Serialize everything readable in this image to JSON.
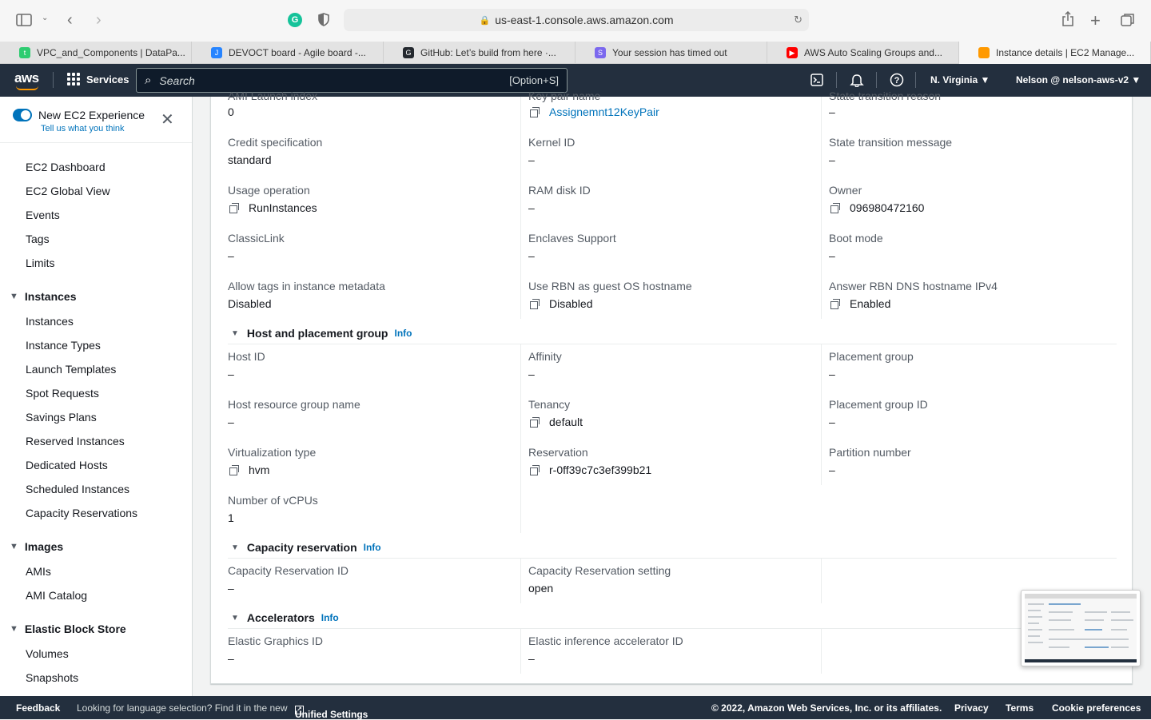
{
  "browser": {
    "url": "us-east-1.console.aws.amazon.com",
    "tabs": [
      {
        "title": "VPC_and_Components | DataPa...",
        "color": "#2ecc71",
        "glyph": "t"
      },
      {
        "title": "DEVOCT board - Agile board -...",
        "color": "#2684ff",
        "glyph": "J"
      },
      {
        "title": "GitHub: Let’s build from here ·...",
        "color": "#24292f",
        "glyph": "G"
      },
      {
        "title": "Your session has timed out",
        "color": "#7b68ee",
        "glyph": "S"
      },
      {
        "title": "AWS Auto Scaling Groups and...",
        "color": "#ff0000",
        "glyph": "▶"
      },
      {
        "title": "Instance details | EC2 Manage...",
        "color": "#ff9900",
        "glyph": "",
        "active": true
      }
    ]
  },
  "aws_nav": {
    "logo": "aws",
    "services": "Services",
    "search_placeholder": "Search",
    "search_shortcut": "[Option+S]",
    "region": "N. Virginia",
    "account": "Nelson @ nelson-aws-v2"
  },
  "sidebar": {
    "experience_title": "New EC2 Experience",
    "experience_link": "Tell us what you think",
    "top_items": [
      "EC2 Dashboard",
      "EC2 Global View",
      "Events",
      "Tags",
      "Limits"
    ],
    "sections": [
      {
        "title": "Instances",
        "items": [
          "Instances",
          "Instance Types",
          "Launch Templates",
          "Spot Requests",
          "Savings Plans",
          "Reserved Instances",
          "Dedicated Hosts",
          "Scheduled Instances",
          "Capacity Reservations"
        ]
      },
      {
        "title": "Images",
        "items": [
          "AMIs",
          "AMI Catalog"
        ]
      },
      {
        "title": "Elastic Block Store",
        "items": [
          "Volumes",
          "Snapshots"
        ]
      }
    ]
  },
  "details": {
    "clipped_labels": [
      "AMI Launch index",
      "Key pair name",
      "State transition reason"
    ],
    "top_values": {
      "launch_index": "0",
      "key_pair": "Assignemnt12KeyPair",
      "state_reason": "–"
    },
    "rows": [
      [
        {
          "label": "Credit specification",
          "value": "standard"
        },
        {
          "label": "Kernel ID",
          "value": "–"
        },
        {
          "label": "State transition message",
          "value": "–"
        }
      ],
      [
        {
          "label": "Usage operation",
          "value": "RunInstances",
          "copy": true
        },
        {
          "label": "RAM disk ID",
          "value": "–"
        },
        {
          "label": "Owner",
          "value": "096980472160",
          "copy": true
        }
      ],
      [
        {
          "label": "ClassicLink",
          "value": "–"
        },
        {
          "label": "Enclaves Support",
          "value": "–"
        },
        {
          "label": "Boot mode",
          "value": "–"
        }
      ],
      [
        {
          "label": "Allow tags in instance metadata",
          "value": "Disabled"
        },
        {
          "label": "Use RBN as guest OS hostname",
          "value": "Disabled",
          "copy": true
        },
        {
          "label": "Answer RBN DNS hostname IPv4",
          "value": "Enabled",
          "copy": true
        }
      ]
    ],
    "host_group": {
      "title": "Host and placement group",
      "info": "Info",
      "rows": [
        [
          {
            "label": "Host ID",
            "value": "–"
          },
          {
            "label": "Affinity",
            "value": "–"
          },
          {
            "label": "Placement group",
            "value": "–"
          }
        ],
        [
          {
            "label": "Host resource group name",
            "value": "–"
          },
          {
            "label": "Tenancy",
            "value": "default",
            "copy": true
          },
          {
            "label": "Placement group ID",
            "value": "–"
          }
        ],
        [
          {
            "label": "Virtualization type",
            "value": "hvm",
            "copy": true
          },
          {
            "label": "Reservation",
            "value": "r-0ff39c7c3ef399b21",
            "copy": true
          },
          {
            "label": "Partition number",
            "value": "–"
          }
        ],
        [
          {
            "label": "Number of vCPUs",
            "value": "1"
          }
        ]
      ]
    },
    "capacity": {
      "title": "Capacity reservation",
      "info": "Info",
      "fields": [
        {
          "label": "Capacity Reservation ID",
          "value": "–"
        },
        {
          "label": "Capacity Reservation setting",
          "value": "open"
        }
      ]
    },
    "accelerators": {
      "title": "Accelerators",
      "info": "Info",
      "fields": [
        {
          "label": "Elastic Graphics ID",
          "value": "–"
        },
        {
          "label": "Elastic inference accelerator ID",
          "value": "–"
        }
      ]
    }
  },
  "footer": {
    "feedback": "Feedback",
    "language_note": "Looking for language selection? Find it in the new",
    "unified_settings": "Unified Settings",
    "copyright": "© 2022, Amazon Web Services, Inc. or its affiliates.",
    "privacy": "Privacy",
    "terms": "Terms",
    "cookies": "Cookie preferences"
  },
  "colors": {
    "nav": "#232f3e",
    "link": "#0073bb",
    "accent": "#ff9900"
  }
}
